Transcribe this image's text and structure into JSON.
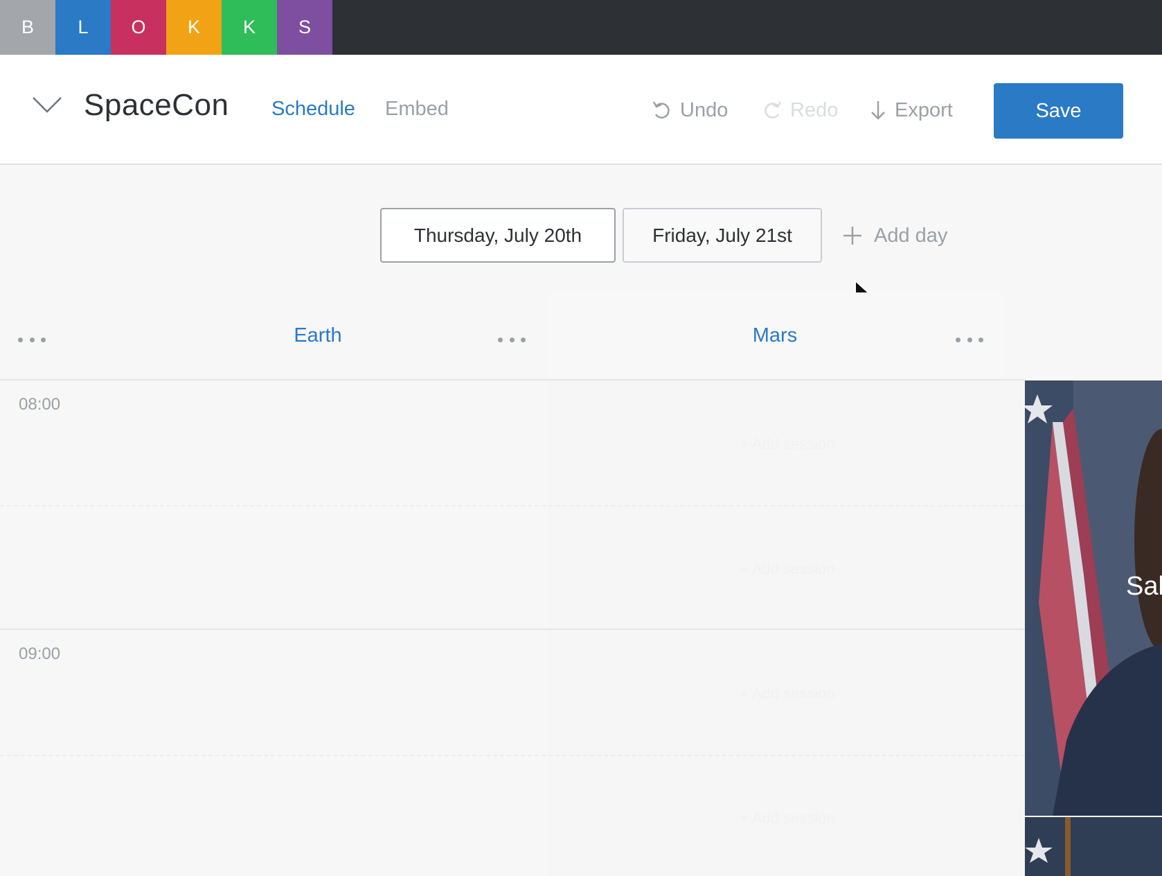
{
  "logo": {
    "tiles": [
      {
        "letter": "B",
        "color": "#a3a6ab"
      },
      {
        "letter": "L",
        "color": "#2a7ac6"
      },
      {
        "letter": "O",
        "color": "#c8305f"
      },
      {
        "letter": "K",
        "color": "#f1a315"
      },
      {
        "letter": "K",
        "color": "#2ebd59"
      },
      {
        "letter": "S",
        "color": "#7e4fa1"
      }
    ]
  },
  "header": {
    "title": "SpaceCon",
    "tabs": [
      {
        "label": "Schedule",
        "active": true
      },
      {
        "label": "Embed",
        "active": false
      }
    ],
    "undo_label": "Undo",
    "redo_label": "Redo",
    "export_label": "Export",
    "save_label": "Save"
  },
  "days": {
    "items": [
      {
        "label": "Thursday, July 20th",
        "selected": true
      },
      {
        "label": "Friday, July 21st",
        "selected": false
      }
    ],
    "add_label": "Add day"
  },
  "tracks": [
    {
      "name": "Earth"
    },
    {
      "name": "Mars"
    }
  ],
  "times": [
    "08:00",
    "09:00"
  ],
  "ghost_slot_label": "+ Add session",
  "speaker": {
    "name_partial": "Sal"
  },
  "colors": {
    "accent": "#2a7ac6",
    "muted": "#9aa0a6",
    "topbar": "#2d3035"
  }
}
